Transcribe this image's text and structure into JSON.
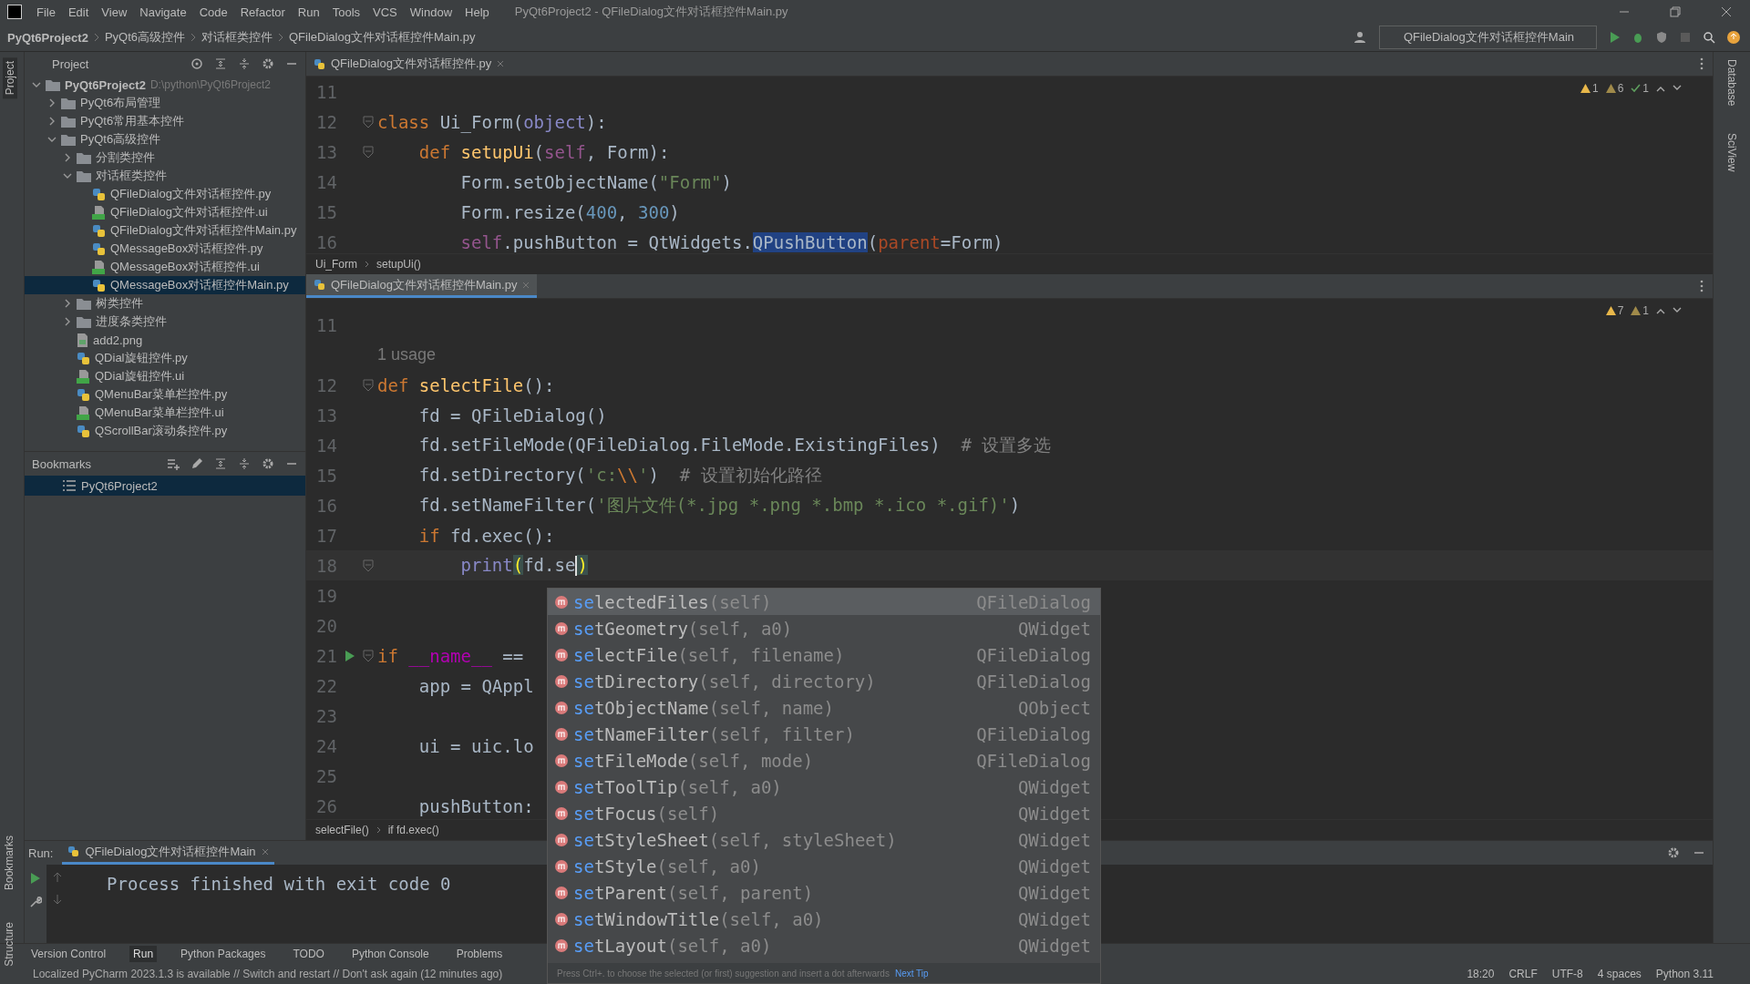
{
  "window": {
    "title": "PyQt6Project2 - QFileDialog文件对话框控件Main.py"
  },
  "menu": [
    "File",
    "Edit",
    "View",
    "Navigate",
    "Code",
    "Refactor",
    "Run",
    "Tools",
    "VCS",
    "Window",
    "Help"
  ],
  "breadcrumb": [
    "PyQt6Project2",
    "PyQt6高级控件",
    "对话框类控件",
    "QFileDialog文件对话框控件Main.py"
  ],
  "run_configuration": "QFileDialog文件对话框控件Main",
  "left_strip": [
    {
      "label": "Project",
      "selected": true
    },
    {
      "label": "Bookmarks",
      "selected": false
    },
    {
      "label": "Structure",
      "selected": false
    }
  ],
  "right_strip": [
    {
      "label": "Database"
    },
    {
      "label": "SciView"
    }
  ],
  "project": {
    "title": "Project",
    "items": [
      {
        "name": "PyQt6Project2",
        "path": "D:\\python\\PyQt6Project2",
        "kind": "folder",
        "expanded": true,
        "selected": false,
        "children": [
          {
            "name": "PyQt6布局管理",
            "kind": "folder",
            "expanded": false,
            "selected": false
          },
          {
            "name": "PyQt6常用基本控件",
            "kind": "folder",
            "expanded": false,
            "selected": false
          },
          {
            "name": "PyQt6高级控件",
            "kind": "folder",
            "expanded": true,
            "selected": false,
            "children": [
              {
                "name": "分割类控件",
                "kind": "folder",
                "expanded": false,
                "selected": false
              },
              {
                "name": "对话框类控件",
                "kind": "folder",
                "expanded": true,
                "selected": false,
                "children": [
                  {
                    "name": "QFileDialog文件对话框控件.py",
                    "kind": "py",
                    "selected": false
                  },
                  {
                    "name": "QFileDialog文件对话框控件.ui",
                    "kind": "ui",
                    "selected": false
                  },
                  {
                    "name": "QFileDialog文件对话框控件Main.py",
                    "kind": "py",
                    "selected": false
                  },
                  {
                    "name": "QMessageBox对话框控件.py",
                    "kind": "py",
                    "selected": false
                  },
                  {
                    "name": "QMessageBox对话框控件.ui",
                    "kind": "ui",
                    "selected": false
                  },
                  {
                    "name": "QMessageBox对话框控件Main.py",
                    "kind": "py",
                    "selected": true
                  }
                ]
              },
              {
                "name": "树类控件",
                "kind": "folder",
                "expanded": false,
                "selected": false
              },
              {
                "name": "进度条类控件",
                "kind": "folder",
                "expanded": false,
                "selected": false
              },
              {
                "name": "add2.png",
                "kind": "png",
                "selected": false
              },
              {
                "name": "QDial旋钮控件.py",
                "kind": "py",
                "selected": false
              },
              {
                "name": "QDial旋钮控件.ui",
                "kind": "ui",
                "selected": false
              },
              {
                "name": "QMenuBar菜单栏控件.py",
                "kind": "py",
                "selected": false
              },
              {
                "name": "QMenuBar菜单栏控件.ui",
                "kind": "ui",
                "selected": false
              },
              {
                "name": "QScrollBar滚动条控件.py",
                "kind": "py",
                "selected": false
              }
            ]
          }
        ]
      }
    ]
  },
  "bookmarks": {
    "title": "Bookmarks",
    "items": [
      {
        "name": "PyQt6Project2",
        "selected": true
      }
    ]
  },
  "editors": [
    {
      "tab": {
        "label": "QFileDialog文件对话框控件.py",
        "selected": false
      },
      "inspections": [
        {
          "kind": "warning",
          "count": "1"
        },
        {
          "kind": "weak",
          "count": "6"
        },
        {
          "kind": "ok",
          "count": "1"
        }
      ],
      "lines": [
        {
          "kind": "code",
          "number": "11"
        },
        {
          "kind": "code",
          "number": "12",
          "fold": true,
          "tokens": [
            {
              "kind": "kw",
              "text": "class "
            },
            {
              "kind": "plain",
              "text": "Ui_Form("
            },
            {
              "kind": "builtin",
              "text": "object"
            },
            {
              "kind": "plain",
              "text": "):"
            }
          ]
        },
        {
          "kind": "code",
          "number": "13",
          "fold": true,
          "tokens": [
            {
              "kind": "kw",
              "text": "    def "
            },
            {
              "kind": "fn",
              "text": "setupUi"
            },
            {
              "kind": "plain",
              "text": "("
            },
            {
              "kind": "self",
              "text": "self"
            },
            {
              "kind": "plain",
              "text": ", Form):"
            }
          ]
        },
        {
          "kind": "code",
          "number": "14",
          "tokens": [
            {
              "kind": "plain",
              "text": "        Form.setObjectName("
            },
            {
              "kind": "str",
              "text": "\"Form\""
            },
            {
              "kind": "plain",
              "text": ")"
            }
          ]
        },
        {
          "kind": "code",
          "number": "15",
          "tokens": [
            {
              "kind": "plain",
              "text": "        Form.resize("
            },
            {
              "kind": "num",
              "text": "400"
            },
            {
              "kind": "plain",
              "text": ", "
            },
            {
              "kind": "num",
              "text": "300"
            },
            {
              "kind": "plain",
              "text": ")"
            }
          ]
        },
        {
          "kind": "code",
          "number": "16",
          "tokens": [
            {
              "kind": "self",
              "text": "        self"
            },
            {
              "kind": "plain",
              "text": ".pushButton = QtWidgets."
            },
            {
              "kind": "hl",
              "text": "QPushButton"
            },
            {
              "kind": "plain",
              "text": "("
            },
            {
              "kind": "param",
              "text": "parent"
            },
            {
              "kind": "plain",
              "text": "=Form)"
            }
          ]
        }
      ],
      "breadcrumb": [
        "Ui_Form",
        "setupUi()"
      ]
    },
    {
      "tab": {
        "label": "QFileDialog文件对话框控件Main.py",
        "selected": true
      },
      "inspections": [
        {
          "kind": "warning",
          "count": "7"
        },
        {
          "kind": "weak",
          "count": "1"
        }
      ],
      "lines": [
        {
          "kind": "code",
          "number": "11"
        },
        {
          "kind": "hint",
          "text": "1 usage"
        },
        {
          "kind": "code",
          "number": "12",
          "fold": true,
          "tokens": [
            {
              "kind": "kw",
              "text": "def "
            },
            {
              "kind": "fn",
              "text": "selectFile"
            },
            {
              "kind": "plain",
              "text": "():"
            }
          ]
        },
        {
          "kind": "code",
          "number": "13",
          "tokens": [
            {
              "kind": "plain",
              "text": "    fd = QFileDialog()"
            }
          ]
        },
        {
          "kind": "code",
          "number": "14",
          "tokens": [
            {
              "kind": "plain",
              "text": "    fd.setFileMode(QFileDialog.FileMode.ExistingFiles)  "
            },
            {
              "kind": "comment",
              "text": "# 设置多选"
            }
          ]
        },
        {
          "kind": "code",
          "number": "15",
          "tokens": [
            {
              "kind": "plain",
              "text": "    fd.setDirectory("
            },
            {
              "kind": "str",
              "text": "'c:"
            },
            {
              "kind": "esc",
              "text": "\\\\"
            },
            {
              "kind": "str",
              "text": "'"
            },
            {
              "kind": "plain",
              "text": ")  "
            },
            {
              "kind": "comment",
              "text": "# 设置初始化路径"
            }
          ]
        },
        {
          "kind": "code",
          "number": "16",
          "tokens": [
            {
              "kind": "plain",
              "text": "    fd.setNameFilter("
            },
            {
              "kind": "str",
              "text": "'图片文件(*.jpg *.png *.bmp *.ico *.gif)'"
            },
            {
              "kind": "plain",
              "text": ")"
            }
          ]
        },
        {
          "kind": "code",
          "number": "17",
          "tokens": [
            {
              "kind": "kw",
              "text": "    if "
            },
            {
              "kind": "plain",
              "text": "fd.exec():"
            }
          ]
        },
        {
          "kind": "code",
          "number": "18",
          "current": true,
          "fold": true,
          "tokens": [
            {
              "kind": "builtin",
              "text": "        print"
            },
            {
              "kind": "match",
              "text": "("
            },
            {
              "kind": "plain",
              "text": "fd.se",
              "caret": true
            },
            {
              "kind": "match",
              "text": ")"
            }
          ]
        },
        {
          "kind": "code",
          "number": "19"
        },
        {
          "kind": "code",
          "number": "20"
        },
        {
          "kind": "code",
          "number": "21",
          "run": true,
          "fold": true,
          "tokens": [
            {
              "kind": "kw",
              "text": "if "
            },
            {
              "kind": "dunder",
              "text": "__name__"
            },
            {
              "kind": "plain",
              "text": " =="
            }
          ]
        },
        {
          "kind": "code",
          "number": "22",
          "tokens": [
            {
              "kind": "plain",
              "text": "    app = QAppl"
            }
          ]
        },
        {
          "kind": "code",
          "number": "23"
        },
        {
          "kind": "code",
          "number": "24",
          "tokens": [
            {
              "kind": "plain",
              "text": "    ui = uic.lo"
            }
          ]
        },
        {
          "kind": "code",
          "number": "25"
        },
        {
          "kind": "code",
          "number": "26",
          "tokens": [
            {
              "kind": "plain",
              "text": "    pushButton:"
            }
          ]
        }
      ],
      "breadcrumb": [
        "selectFile()",
        "if fd.exec()"
      ]
    }
  ],
  "completion": {
    "items": [
      {
        "match": "se",
        "name": "lectedFiles",
        "params": "(self)",
        "owner": "QFileDialog",
        "selected": true
      },
      {
        "match": "se",
        "name": "tGeometry",
        "params": "(self, a0)",
        "owner": "QWidget",
        "selected": false
      },
      {
        "match": "se",
        "name": "lectFile",
        "params": "(self, filename)",
        "owner": "QFileDialog",
        "selected": false
      },
      {
        "match": "se",
        "name": "tDirectory",
        "params": "(self, directory)",
        "owner": "QFileDialog",
        "selected": false
      },
      {
        "match": "se",
        "name": "tObjectName",
        "params": "(self, name)",
        "owner": "QObject",
        "selected": false
      },
      {
        "match": "se",
        "name": "tNameFilter",
        "params": "(self, filter)",
        "owner": "QFileDialog",
        "selected": false
      },
      {
        "match": "se",
        "name": "tFileMode",
        "params": "(self, mode)",
        "owner": "QFileDialog",
        "selected": false
      },
      {
        "match": "se",
        "name": "tToolTip",
        "params": "(self, a0)",
        "owner": "QWidget",
        "selected": false
      },
      {
        "match": "se",
        "name": "tFocus",
        "params": "(self)",
        "owner": "QWidget",
        "selected": false
      },
      {
        "match": "se",
        "name": "tStyleSheet",
        "params": "(self, styleSheet)",
        "owner": "QWidget",
        "selected": false
      },
      {
        "match": "se",
        "name": "tStyle",
        "params": "(self, a0)",
        "owner": "QWidget",
        "selected": false
      },
      {
        "match": "se",
        "name": "tParent",
        "params": "(self, parent)",
        "owner": "QWidget",
        "selected": false
      },
      {
        "match": "se",
        "name": "tWindowTitle",
        "params": "(self, a0)",
        "owner": "QWidget",
        "selected": false
      },
      {
        "match": "se",
        "name": "tLayout",
        "params": "(self, a0)",
        "owner": "QWidget",
        "selected": false
      }
    ],
    "tip": "Press Ctrl+. to choose the selected (or first) suggestion and insert a dot afterwards",
    "tip_link": "Next Tip"
  },
  "run": {
    "label": "Run:",
    "tab": "QFileDialog文件对话框控件Main",
    "output": "Process finished with exit code 0"
  },
  "tool_tabs": [
    {
      "label": "Version Control",
      "selected": false
    },
    {
      "label": "Run",
      "selected": true
    },
    {
      "label": "Python Packages",
      "selected": false
    },
    {
      "label": "TODO",
      "selected": false
    },
    {
      "label": "Python Console",
      "selected": false
    },
    {
      "label": "Problems",
      "selected": false
    }
  ],
  "status_bar": {
    "message": "Localized PyCharm 2023.1.3 is available // Switch and restart // Don't ask again (12 minutes ago)",
    "items": [
      "18:20",
      "CRLF",
      "UTF-8",
      "4 spaces",
      "Python 3.11"
    ]
  }
}
